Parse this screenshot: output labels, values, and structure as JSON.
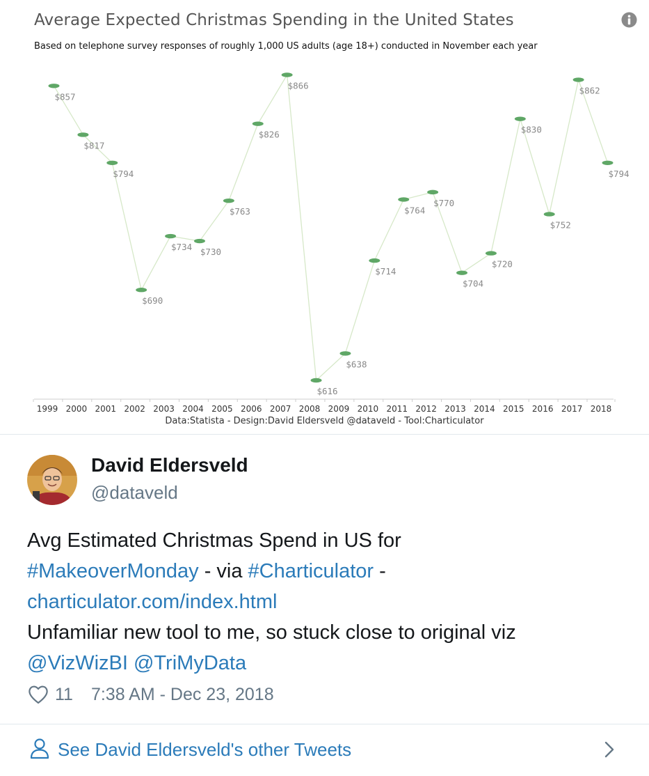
{
  "chart": {
    "title": "Average Expected Christmas Spending in the United States",
    "subtitle": "Based on telephone survey responses of roughly 1,000 US adults (age 18+) conducted in November each year",
    "credit": "Data:Statista - Design:David Eldersveld @dataveld - Tool:Charticulator",
    "info_icon": "info-icon",
    "colors": {
      "point": "#5fa766",
      "line": "#d6e8c8",
      "label": "#888888",
      "axis": "#cccccc",
      "axis_text": "#333333"
    }
  },
  "chart_data": {
    "type": "line",
    "title": "Average Expected Christmas Spending in the United States",
    "subtitle": "Based on telephone survey responses of roughly 1,000 US adults (age 18+) conducted in November each year",
    "xlabel": "",
    "ylabel": "",
    "grid": false,
    "legend": "none",
    "x": [
      "1999",
      "2000",
      "2001",
      "2002",
      "2003",
      "2004",
      "2005",
      "2006",
      "2007",
      "2008",
      "2009",
      "2010",
      "2011",
      "2012",
      "2013",
      "2014",
      "2015",
      "2016",
      "2017",
      "2018"
    ],
    "values": [
      857,
      817,
      794,
      690,
      734,
      730,
      763,
      826,
      866,
      616,
      638,
      714,
      764,
      770,
      704,
      720,
      830,
      752,
      862,
      794
    ],
    "labels": [
      "$857",
      "$817",
      "$794",
      "$690",
      "$734",
      "$730",
      "$763",
      "$826",
      "$866",
      "$616",
      "$638",
      "$714",
      "$764",
      "$770",
      "$704",
      "$720",
      "$830",
      "$752",
      "$862",
      "$794"
    ]
  },
  "tweet": {
    "author_name": "David Eldersveld",
    "author_handle": "@dataveld",
    "text": {
      "l1": "Avg Estimated Christmas Spend in US for",
      "tag1": "#MakeoverMonday",
      "via": " - via ",
      "tag2": "#Charticulator",
      "dash": " -",
      "url": "charticulator.com/index.html",
      "l4": "Unfamiliar new tool to me, so stuck close to original viz",
      "mention1": "@VizWizBI",
      "mention2": "@TriMyData"
    },
    "likes": "11",
    "timestamp": "7:38 AM - Dec 23, 2018",
    "footer_link": "See David Eldersveld's other Tweets",
    "icons": {
      "like": "heart-icon",
      "footer": "person-icon",
      "chevron": "chevron-right-icon",
      "avatar": "avatar"
    },
    "colors": {
      "link": "#2b7bb9",
      "muted": "#657786",
      "text": "#14171a"
    }
  }
}
